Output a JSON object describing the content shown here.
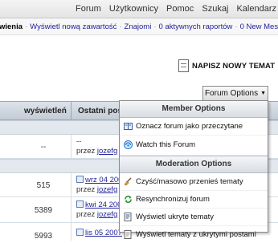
{
  "topnav": {
    "items": [
      "Forum",
      "Użytkownicy",
      "Pomoc",
      "Szukaj",
      "Kalendarz"
    ]
  },
  "linkbar": {
    "current": "wienia",
    "links": [
      "Wyświetl nową zawartość",
      "Znajomi",
      "0 aktywnych raportów",
      "0 New Messages"
    ]
  },
  "new_topic": {
    "label": "NAPISZ NOWY TEMAT",
    "icon": "new-topic-doc-icon"
  },
  "forum_options": {
    "label": "Forum Options",
    "arrow": "▼"
  },
  "table": {
    "headers": {
      "views": "wyświetleń",
      "last_post": "Ostatni post"
    },
    "rows": [
      {
        "views": "--",
        "line1": "--",
        "by": "przez",
        "user": "jozefg"
      },
      {
        "views": "515",
        "line1": "wrz 04 2006",
        "by": "przez",
        "user": "jozefg"
      },
      {
        "views": "5389",
        "line1": "kwi 24 2006",
        "by": "przez",
        "user": "jozefg"
      },
      {
        "views": "5993",
        "line1": "lis 05 2007",
        "by": "",
        "user": ""
      }
    ]
  },
  "menu": {
    "member_header": "Member Options",
    "member_items": [
      {
        "label": "Oznacz forum jako przeczytane",
        "icon": "mark-read-icon"
      },
      {
        "label": "Watch this Forum",
        "icon": "watch-forum-icon"
      }
    ],
    "moderation_header": "Moderation Options",
    "moderation_items": [
      {
        "label": "Czyść/masowo przenieś tematy",
        "icon": "broom-icon"
      },
      {
        "label": "Resynchronizuj forum",
        "icon": "resync-icon"
      },
      {
        "label": "Wyświetl ukryte tematy",
        "icon": "hidden-topics-icon"
      },
      {
        "label": "Wyświetl tematy z ukrytymi postami",
        "icon": "hidden-posts-icon"
      }
    ]
  },
  "colors": {
    "link": "#22229c",
    "header_bg": "#c3cbd5",
    "menu_header_bg": "#d9dde3"
  }
}
